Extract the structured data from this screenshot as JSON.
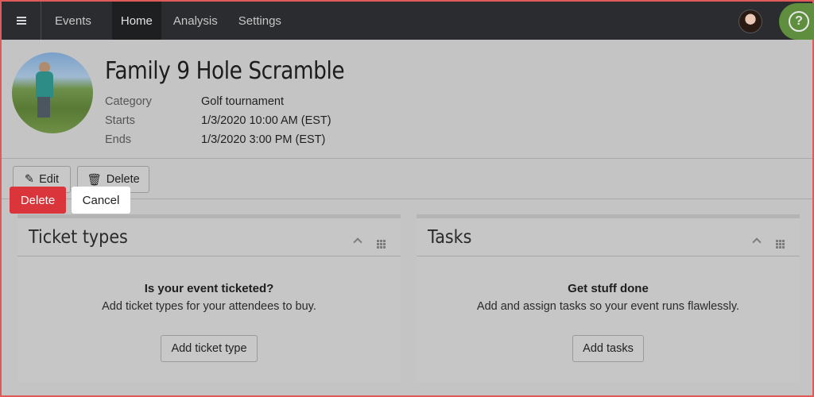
{
  "nav": {
    "menu_icon": "hamburger-icon",
    "items": [
      {
        "label": "Events"
      },
      {
        "label": "Home"
      },
      {
        "label": "Analysis"
      },
      {
        "label": "Settings"
      }
    ],
    "active": "Home",
    "help_icon": "question-circle-icon",
    "help_symbol": "?"
  },
  "event": {
    "title": "Family 9 Hole Scramble",
    "details": [
      {
        "label": "Category",
        "value": "Golf tournament"
      },
      {
        "label": "Starts",
        "value": "1/3/2020 10:00 AM (EST)"
      },
      {
        "label": "Ends",
        "value": "1/3/2020 3:00 PM (EST)"
      }
    ]
  },
  "actions": {
    "edit_label": "Edit",
    "delete_label": "Delete"
  },
  "confirm": {
    "delete_label": "Delete",
    "cancel_label": "Cancel"
  },
  "cards": [
    {
      "title": "Ticket types",
      "headline": "Is your event ticketed?",
      "text": "Add ticket types for your attendees to buy.",
      "button": "Add ticket type"
    },
    {
      "title": "Tasks",
      "headline": "Get stuff done",
      "text": "Add and assign tasks so your event runs flawlessly.",
      "button": "Add tasks"
    }
  ],
  "colors": {
    "danger": "#d9353a",
    "help": "#5f8f3e",
    "topbar": "#2b2c2f"
  }
}
